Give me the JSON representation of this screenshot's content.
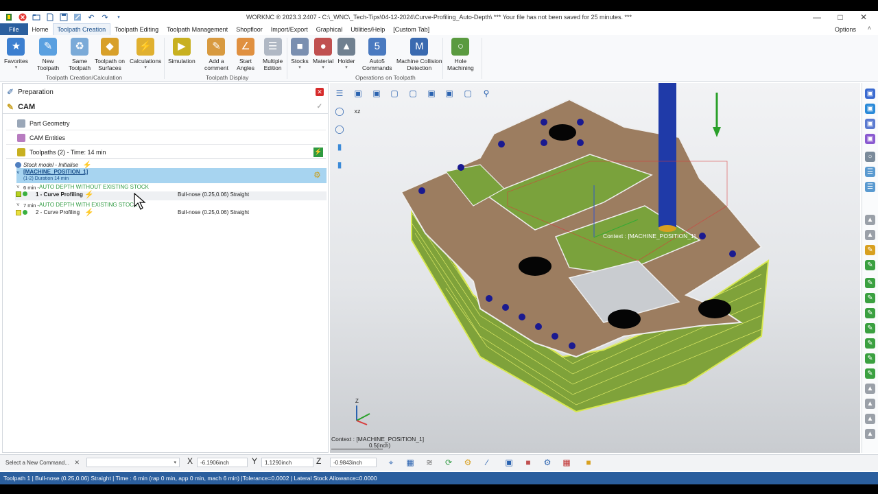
{
  "title_bar": {
    "title": "WORKNC ® 2023.3.2407 - C:\\_WNC\\_Tech-Tips\\04-12-2024\\Curve-Profiling_Auto-Depth\\ *** Your file has not been saved for 25 minutes. ***",
    "quick_access_icons": [
      "app-icon",
      "close-doc-icon",
      "open-folder-icon",
      "new-doc-icon",
      "save-icon",
      "settings-icon",
      "undo-icon",
      "redo-icon",
      "qa-dropdown-icon"
    ],
    "window_controls": [
      "minimize-icon",
      "maximize-icon",
      "close-icon"
    ]
  },
  "menu": {
    "items": [
      {
        "label": "File",
        "kind": "file"
      },
      {
        "label": "Home",
        "kind": "normal"
      },
      {
        "label": "Toolpath Creation",
        "kind": "active"
      },
      {
        "label": "Toolpath Editing",
        "kind": "normal"
      },
      {
        "label": "Toolpath Management",
        "kind": "normal"
      },
      {
        "label": "Shopfloor",
        "kind": "normal"
      },
      {
        "label": "Import/Export",
        "kind": "normal"
      },
      {
        "label": "Graphical",
        "kind": "normal"
      },
      {
        "label": "Utilities/Help",
        "kind": "normal"
      },
      {
        "label": "[Custom Tab]",
        "kind": "normal"
      }
    ],
    "options_label": "Options"
  },
  "ribbon": {
    "buttons": [
      {
        "label1": "Favorites",
        "label2": "",
        "icon": "star-icon",
        "color": "#3c7fd0"
      },
      {
        "label1": "New",
        "label2": "Toolpath",
        "icon": "new-toolpath-icon",
        "color": "#5aa0e0"
      },
      {
        "label1": "Same",
        "label2": "Toolpath",
        "icon": "same-toolpath-icon",
        "color": "#7aaad8"
      },
      {
        "label1": "Toolpath on",
        "label2": "Surfaces",
        "icon": "toolpath-surfaces-icon",
        "color": "#d8a02a"
      },
      {
        "label1": "Calculations",
        "label2": "",
        "icon": "calculations-icon",
        "color": "#e0b030"
      },
      {
        "label1": "Simulation",
        "label2": "",
        "icon": "simulation-icon",
        "color": "#c8b020"
      },
      {
        "label1": "Add a",
        "label2": "comment",
        "icon": "comment-icon",
        "color": "#d89a40"
      },
      {
        "label1": "Start",
        "label2": "Angles",
        "icon": "start-angles-icon",
        "color": "#e09040"
      },
      {
        "label1": "Multiple",
        "label2": "Edition",
        "icon": "multiple-edition-icon",
        "color": "#b0b8c4"
      },
      {
        "label1": "Stocks",
        "label2": "",
        "icon": "stocks-icon",
        "color": "#7a8fb0"
      },
      {
        "label1": "Material",
        "label2": "",
        "icon": "material-icon",
        "color": "#c05050"
      },
      {
        "label1": "Holder",
        "label2": "",
        "icon": "holder-icon",
        "color": "#708090"
      },
      {
        "label1": "Auto5",
        "label2": "Commands",
        "icon": "auto5-icon",
        "color": "#4a7ac0"
      },
      {
        "label1": "Machine Collision",
        "label2": "Detection",
        "icon": "collision-icon",
        "color": "#3a6ab0"
      },
      {
        "label1": "Hole",
        "label2": "Machining",
        "icon": "hole-machining-icon",
        "color": "#5a9a40"
      }
    ],
    "groups": [
      "Toolpath Creation/Calculation",
      "Toolpath Display",
      "Operations on Toolpath"
    ]
  },
  "panel": {
    "preparation": "Preparation",
    "cam": "CAM",
    "rows": [
      {
        "label": "Part Geometry"
      },
      {
        "label": "CAM Entities"
      },
      {
        "label": "Toolpaths (2) - Time: 14 min"
      }
    ],
    "stock_model": "Stock model - Initialise",
    "machine_position": "[MACHINE_POSITION_1]",
    "machine_duration": "(1-2) Duration 14 min",
    "seq1_time": "6 min -",
    "seq1_label": "AUTO DEPTH WITHOUT EXISTING STOCK",
    "toolpath1": {
      "name": "1 - Curve Profiling",
      "tool": "Bull-nose (0.25,0.06) Straight"
    },
    "seq2_time": "7 min -",
    "seq2_label": "AUTO DEPTH WITH EXISTING STOCK",
    "toolpath2": {
      "name": "2 - Curve Profiling",
      "tool": "Bull-nose (0.25,0.06) Straight"
    }
  },
  "viewport": {
    "context_label": "Context : [MACHINE_POSITION_1]",
    "context_bottom": "Context : [MACHINE_POSITION_1]",
    "scale_label": "0.5(inch)",
    "axis_z": "Z"
  },
  "command_bar": {
    "select_placeholder": "Select a New Command...",
    "x_label": "X",
    "x_value": "-6.1906inch",
    "y_label": "Y",
    "y_value": "1.1290inch",
    "z_label": "Z",
    "z_value": "-0.9843inch"
  },
  "status": "Toolpath 1 | Bull-nose (0.25,0.06) Straight | Time : 6 min (rap 0 min, app 0 min, mach 6 min) |Tolerance=0.0002 | Lateral Stock Allowance=0.0000"
}
